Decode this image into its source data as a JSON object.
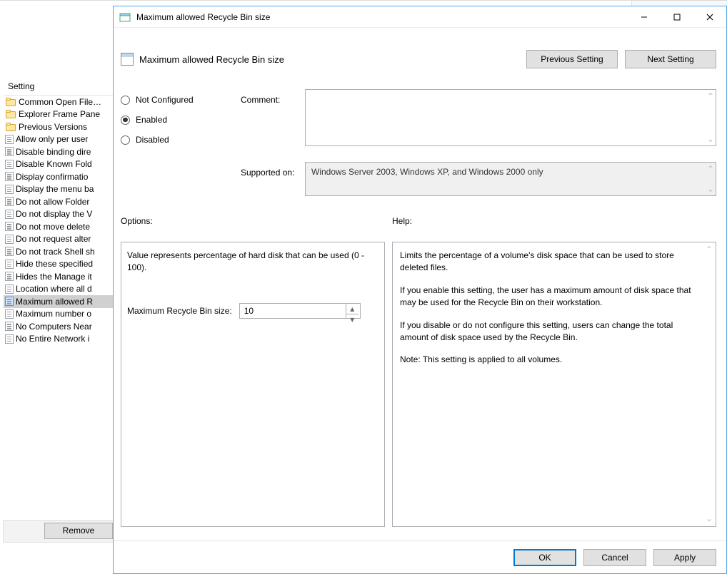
{
  "back": {
    "column_header": "Setting",
    "rows": [
      {
        "icon": "folder",
        "label": "Common Open File…"
      },
      {
        "icon": "folder",
        "label": "Explorer Frame Pane"
      },
      {
        "icon": "folder",
        "label": "Previous Versions"
      },
      {
        "icon": "policy",
        "label": "Allow only per user "
      },
      {
        "icon": "policy",
        "label": "Disable binding dire"
      },
      {
        "icon": "policy",
        "label": "Disable Known Fold"
      },
      {
        "icon": "policy",
        "label": "Display confirmatio"
      },
      {
        "icon": "policy",
        "label": "Display the menu ba"
      },
      {
        "icon": "policy",
        "label": "Do not allow Folder"
      },
      {
        "icon": "policy",
        "label": "Do not display the V"
      },
      {
        "icon": "policy",
        "label": "Do not move delete"
      },
      {
        "icon": "policy",
        "label": "Do not request alter"
      },
      {
        "icon": "policy",
        "label": "Do not track Shell sh"
      },
      {
        "icon": "policy",
        "label": "Hide these specified"
      },
      {
        "icon": "policy",
        "label": "Hides the Manage it"
      },
      {
        "icon": "policy",
        "label": "Location where all d"
      },
      {
        "icon": "policy",
        "label": "Maximum allowed R",
        "selected": true
      },
      {
        "icon": "policy",
        "label": "Maximum number o"
      },
      {
        "icon": "policy",
        "label": "No Computers Near"
      },
      {
        "icon": "policy",
        "label": "No Entire Network i"
      }
    ],
    "remove_label": "Remove"
  },
  "dialog": {
    "title": "Maximum allowed Recycle Bin size",
    "header_title": "Maximum allowed Recycle Bin size",
    "prev_label": "Previous Setting",
    "next_label": "Next Setting",
    "radios": {
      "not_configured": "Not Configured",
      "enabled": "Enabled",
      "disabled": "Disabled",
      "selected": "enabled"
    },
    "comment_label": "Comment:",
    "comment_value": "",
    "supported_label": "Supported on:",
    "supported_value": "Windows Server 2003, Windows XP, and Windows 2000 only",
    "options_label": "Options:",
    "help_label": "Help:",
    "options_text": "Value represents percentage of hard disk that can be used (0 - 100).",
    "option_field_label": "Maximum Recycle Bin size:",
    "option_field_value": "10",
    "help_paragraphs": {
      "p1": "Limits the percentage of a volume's disk space that can be used to store deleted files.",
      "p2": "If you enable this setting, the user has a maximum amount of disk space that may be used for the Recycle Bin on their workstation.",
      "p3": "If you disable or do not configure this setting, users can change the total amount of disk space used by the Recycle Bin.",
      "p4": "Note: This setting is applied to all volumes."
    },
    "footer": {
      "ok": "OK",
      "cancel": "Cancel",
      "apply": "Apply"
    }
  }
}
